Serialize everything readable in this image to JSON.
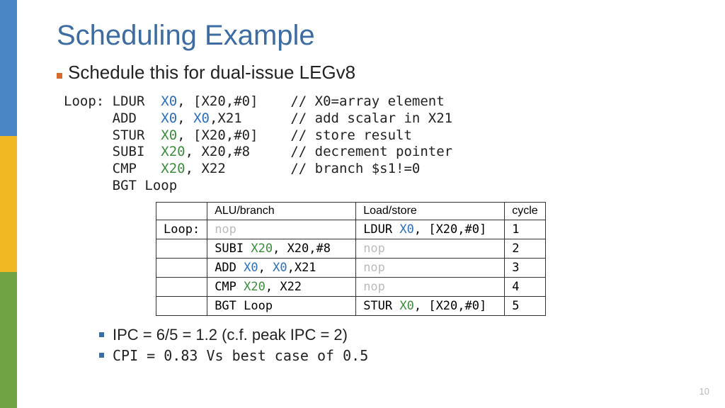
{
  "title": "Scheduling Example",
  "subtitle": "Schedule this for dual-issue LEGv8",
  "code": {
    "lines": [
      {
        "label": "Loop:",
        "op": "LDUR",
        "ra": "X0",
        "cm": ",",
        "rb": "[X20,#0]",
        "comment": "// X0=array element",
        "acolor": "reg",
        "bcolor": ""
      },
      {
        "label": "",
        "op": "ADD",
        "ra": "X0",
        "cm": ",",
        "rb": "X0",
        "rbcolor": "reg",
        "rc": ",X21",
        "comment": "// add scalar in X21",
        "acolor": "reg"
      },
      {
        "label": "",
        "op": "STUR",
        "ra": "X0",
        "cm": ",",
        "rb": "[X20,#0]",
        "comment": "// store result",
        "acolor": "regg"
      },
      {
        "label": "",
        "op": "SUBI",
        "ra": "X20",
        "cm": ",",
        "rb": "X20,#8",
        "comment": "// decrement pointer",
        "acolor": "regg"
      },
      {
        "label": "",
        "op": "CMP",
        "ra": "X20",
        "cm": ",",
        "rb": "X22",
        "comment": "// branch $s1!=0",
        "acolor": "regg"
      },
      {
        "label": "",
        "op": "BGT Loop",
        "ra": "",
        "cm": "",
        "rb": "",
        "comment": "",
        "acolor": ""
      }
    ]
  },
  "table": {
    "headers": {
      "c0": "",
      "c1": "ALU/branch",
      "c2": "Load/store",
      "c3": "cycle"
    },
    "rows": [
      {
        "label": "Loop:",
        "alu": {
          "txt": "nop",
          "cls": "nop"
        },
        "ls": {
          "pre": "LDUR ",
          "reg": "X0",
          "regcls": "reg",
          "post": ", [X20,#0]"
        },
        "cycle": "1"
      },
      {
        "label": "",
        "alu": {
          "pre": "SUBI ",
          "reg": "X20",
          "regcls": "regg",
          "post": ", X20,#8"
        },
        "ls": {
          "txt": "nop",
          "cls": "nop"
        },
        "cycle": "2"
      },
      {
        "label": "",
        "alu": {
          "pre": "ADD  ",
          "reg": "X0",
          "regcls": "reg",
          "post": ", ",
          "reg2": "X0",
          "reg2cls": "reg",
          "post2": ",X21"
        },
        "ls": {
          "txt": "nop",
          "cls": "nop"
        },
        "cycle": "3"
      },
      {
        "label": "",
        "alu": {
          "pre": "CMP  ",
          "reg": "X20",
          "regcls": "regg",
          "post": ", X22"
        },
        "ls": {
          "txt": "nop",
          "cls": "nop"
        },
        "cycle": "4"
      },
      {
        "label": "",
        "alu": {
          "pre": "BGT Loop"
        },
        "ls": {
          "pre": "STUR ",
          "reg": "X0",
          "regcls": "regg",
          "post": ", [X20,#0]"
        },
        "cycle": "5"
      }
    ]
  },
  "bullets": {
    "b1": "IPC = 6/5 = 1.2 (c.f. peak IPC = 2)",
    "b2": "CPI = 0.83 Vs best case of 0.5"
  },
  "page": "10"
}
